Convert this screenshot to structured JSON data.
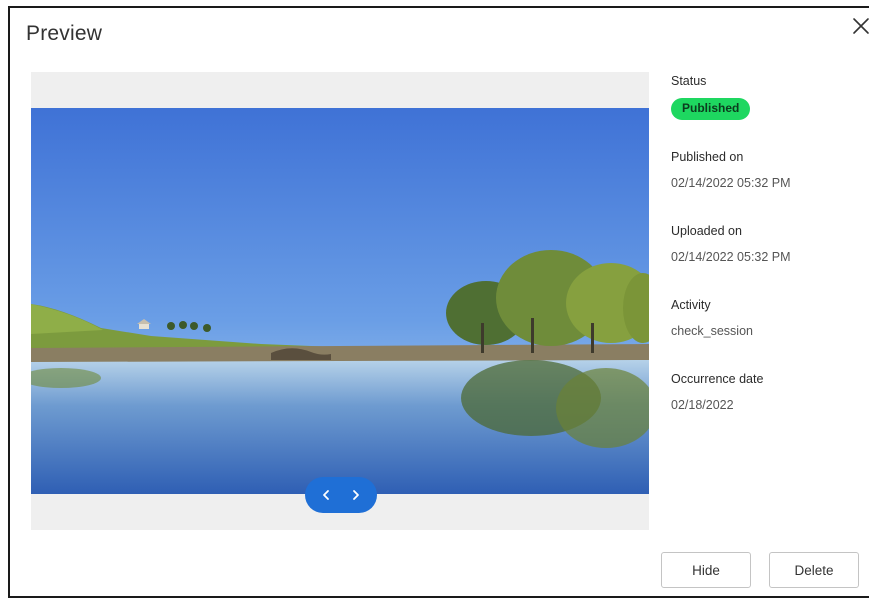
{
  "modal": {
    "title": "Preview",
    "close_icon": "close-icon"
  },
  "preview": {
    "image_description_icon": "landscape-photo",
    "prev_icon": "chevron-left-icon",
    "next_icon": "chevron-right-icon",
    "pager_color": "#1f6fd6"
  },
  "details": {
    "status_label": "Status",
    "status_value": "Published",
    "status_color": "#1ed760",
    "published_label": "Published on",
    "published_value": "02/14/2022 05:32 PM",
    "uploaded_label": "Uploaded on",
    "uploaded_value": "02/14/2022 05:32 PM",
    "activity_label": "Activity",
    "activity_value": "check_session",
    "occurrence_label": "Occurrence date",
    "occurrence_value": "02/18/2022"
  },
  "actions": {
    "hide_label": "Hide",
    "delete_label": "Delete"
  }
}
